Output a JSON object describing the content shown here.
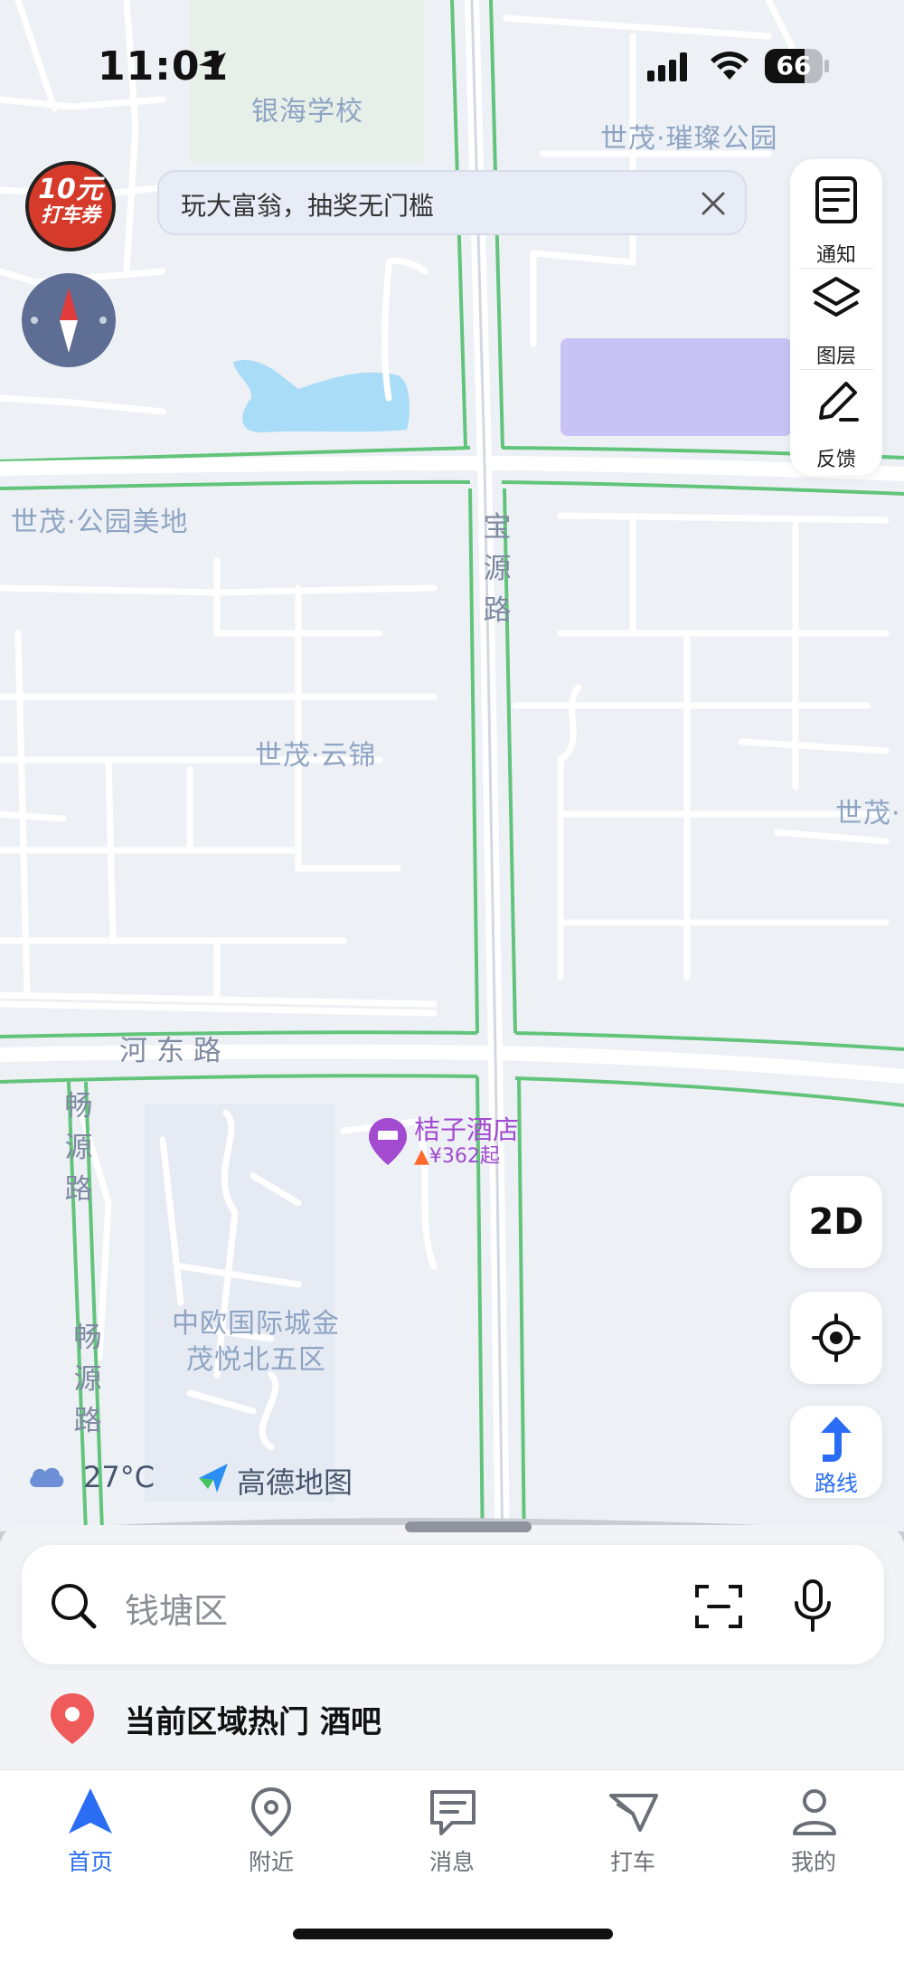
{
  "status_bar": {
    "time": "11:01",
    "battery": "66"
  },
  "coupon": {
    "line1": "10元",
    "line2": "打车券"
  },
  "banner": {
    "text": "玩大富翁，抽奖无门槛"
  },
  "right_panel": {
    "notify": "通知",
    "layers": "图层",
    "feedback": "反馈"
  },
  "map_labels": {
    "school": "银海学校",
    "park_top": "世茂·璀璨公园",
    "gongyuan_meidi": "世茂·公园美地",
    "yunjin": "世茂·云锦",
    "shimao_right": "世茂·",
    "zhongou": "中欧国际城金",
    "zhongou2": "茂悦北五区"
  },
  "road_labels": {
    "baoyuan": "宝源路",
    "hedong": "河 东 路",
    "changyuan": "畅源路"
  },
  "poi": {
    "name": "桔子酒店",
    "price": "¥362起"
  },
  "controls": {
    "view_mode": "2D",
    "route": "路线"
  },
  "weather": {
    "temp": "27°C"
  },
  "brand": {
    "name": "高德地图"
  },
  "search": {
    "placeholder": "钱塘区"
  },
  "hot": {
    "text": "当前区域热门 酒吧"
  },
  "tabs": [
    {
      "label": "首页"
    },
    {
      "label": "附近"
    },
    {
      "label": "消息"
    },
    {
      "label": "打车"
    },
    {
      "label": "我的"
    }
  ],
  "colors": {
    "accent": "#2a6df4",
    "road_outline": "#62c47b",
    "poi": "#a24ad0",
    "coupon": "#d63a2a"
  }
}
